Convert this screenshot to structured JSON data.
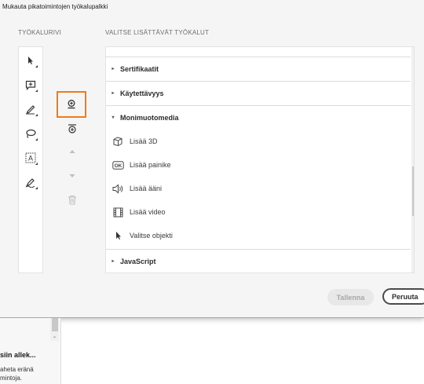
{
  "dialog": {
    "title": "Mukauta pikatoimintojen työkalupalkki",
    "toolbar_label": "TYÖKALURIVI",
    "tools_label": "VALITSE LISÄTTÄVÄT TYÖKALUT",
    "toolbar_items": [
      {
        "name": "select-tool",
        "icon": "cursor-icon"
      },
      {
        "name": "comment-tool",
        "icon": "comment-plus-icon"
      },
      {
        "name": "highlight-tool",
        "icon": "pen-icon"
      },
      {
        "name": "draw-tool",
        "icon": "lasso-icon"
      },
      {
        "name": "text-box-tool",
        "icon": "text-box-icon"
      },
      {
        "name": "sign-tool",
        "icon": "signature-pen-icon"
      }
    ],
    "middle_buttons": [
      {
        "name": "add-tool-button",
        "icon": "stamp-add-icon",
        "selected": true
      },
      {
        "name": "add-divider-button",
        "icon": "add-divider-icon"
      },
      {
        "name": "move-up-button",
        "icon": "arrow-up-icon"
      },
      {
        "name": "move-down-button",
        "icon": "arrow-down-icon"
      },
      {
        "name": "delete-button",
        "icon": "trash-icon"
      }
    ],
    "categories": [
      {
        "label": "Sertifikaatit",
        "expanded": false
      },
      {
        "label": "Käytettävyys",
        "expanded": false
      },
      {
        "label": "Monimuotomedia",
        "expanded": true,
        "items": [
          {
            "label": "Lisää 3D",
            "icon": "cube-icon"
          },
          {
            "label": "Lisää painike",
            "icon": "ok-button-icon"
          },
          {
            "label": "Lisää ääni",
            "icon": "speaker-icon"
          },
          {
            "label": "Lisää video",
            "icon": "film-icon"
          },
          {
            "label": "Valitse objekti",
            "icon": "cursor-icon"
          }
        ]
      },
      {
        "label": "JavaScript",
        "expanded": false
      }
    ],
    "save_label": "Tallenna",
    "cancel_label": "Peruuta"
  },
  "background": {
    "heading": "siin allek...",
    "text_line1": "aheta eränä",
    "text_line2": "mintoja."
  }
}
